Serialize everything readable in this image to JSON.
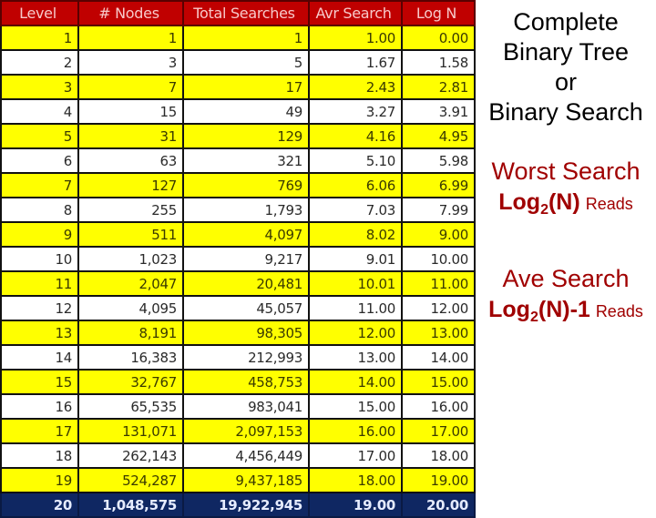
{
  "table": {
    "headers": [
      "Level",
      "# Nodes",
      "Total Searches",
      "Avr Search",
      "Log N"
    ],
    "rows": [
      {
        "level": "1",
        "nodes": "1",
        "total": "1",
        "avr": "1.00",
        "log": "0.00",
        "style": "yellow"
      },
      {
        "level": "2",
        "nodes": "3",
        "total": "5",
        "avr": "1.67",
        "log": "1.58",
        "style": "white"
      },
      {
        "level": "3",
        "nodes": "7",
        "total": "17",
        "avr": "2.43",
        "log": "2.81",
        "style": "yellow"
      },
      {
        "level": "4",
        "nodes": "15",
        "total": "49",
        "avr": "3.27",
        "log": "3.91",
        "style": "white"
      },
      {
        "level": "5",
        "nodes": "31",
        "total": "129",
        "avr": "4.16",
        "log": "4.95",
        "style": "yellow"
      },
      {
        "level": "6",
        "nodes": "63",
        "total": "321",
        "avr": "5.10",
        "log": "5.98",
        "style": "white"
      },
      {
        "level": "7",
        "nodes": "127",
        "total": "769",
        "avr": "6.06",
        "log": "6.99",
        "style": "yellow"
      },
      {
        "level": "8",
        "nodes": "255",
        "total": "1,793",
        "avr": "7.03",
        "log": "7.99",
        "style": "white"
      },
      {
        "level": "9",
        "nodes": "511",
        "total": "4,097",
        "avr": "8.02",
        "log": "9.00",
        "style": "yellow"
      },
      {
        "level": "10",
        "nodes": "1,023",
        "total": "9,217",
        "avr": "9.01",
        "log": "10.00",
        "style": "white"
      },
      {
        "level": "11",
        "nodes": "2,047",
        "total": "20,481",
        "avr": "10.01",
        "log": "11.00",
        "style": "yellow"
      },
      {
        "level": "12",
        "nodes": "4,095",
        "total": "45,057",
        "avr": "11.00",
        "log": "12.00",
        "style": "white"
      },
      {
        "level": "13",
        "nodes": "8,191",
        "total": "98,305",
        "avr": "12.00",
        "log": "13.00",
        "style": "yellow"
      },
      {
        "level": "14",
        "nodes": "16,383",
        "total": "212,993",
        "avr": "13.00",
        "log": "14.00",
        "style": "white"
      },
      {
        "level": "15",
        "nodes": "32,767",
        "total": "458,753",
        "avr": "14.00",
        "log": "15.00",
        "style": "yellow"
      },
      {
        "level": "16",
        "nodes": "65,535",
        "total": "983,041",
        "avr": "15.00",
        "log": "16.00",
        "style": "white"
      },
      {
        "level": "17",
        "nodes": "131,071",
        "total": "2,097,153",
        "avr": "16.00",
        "log": "17.00",
        "style": "yellow"
      },
      {
        "level": "18",
        "nodes": "262,143",
        "total": "4,456,449",
        "avr": "17.00",
        "log": "18.00",
        "style": "white"
      },
      {
        "level": "19",
        "nodes": "524,287",
        "total": "9,437,185",
        "avr": "18.00",
        "log": "19.00",
        "style": "yellow"
      },
      {
        "level": "20",
        "nodes": "1,048,575",
        "total": "19,922,945",
        "avr": "19.00",
        "log": "20.00",
        "style": "navy"
      }
    ]
  },
  "side": {
    "title_lines": [
      "Complete",
      "Binary Tree",
      "or",
      "Binary Search"
    ],
    "worst": {
      "heading": "Worst Search",
      "formula_prefix": "Log",
      "formula_sub": "2",
      "formula_suffix": "(N)",
      "unit": "Reads"
    },
    "ave": {
      "heading": "Ave Search",
      "formula_prefix": "Log",
      "formula_sub": "2",
      "formula_suffix": "(N)-1",
      "unit": "Reads"
    }
  },
  "colors": {
    "header_bg": "#c00000",
    "highlight_row": "#ffff00",
    "final_row": "#0f2762",
    "accent_text": "#a00000"
  }
}
